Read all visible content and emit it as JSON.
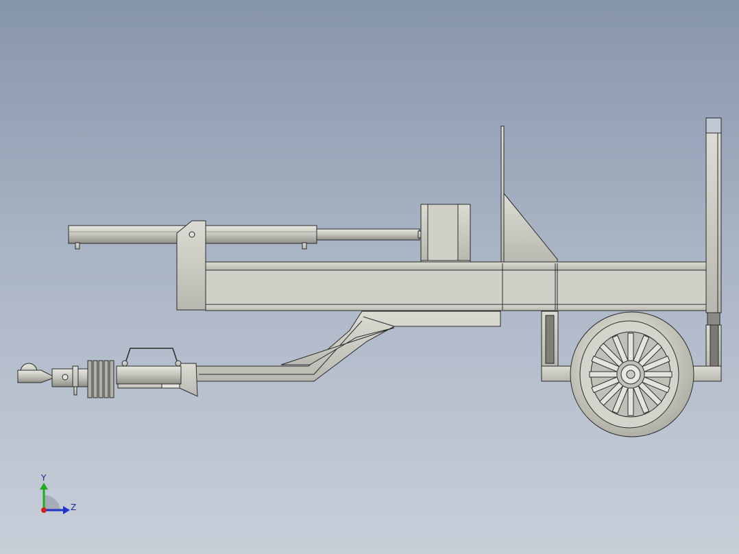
{
  "viewport": {
    "background_top": "#8795ab",
    "background_bottom": "#c9cfd9"
  },
  "model": {
    "part_color": "#c8c8c0",
    "shade_color": "#a8a8a0",
    "edge_color": "#2a2a2a"
  },
  "triad": {
    "y_label": "Y",
    "z_label": "Z",
    "y_color": "#22aa22",
    "z_color": "#2233cc",
    "x_color": "#cc2222"
  }
}
